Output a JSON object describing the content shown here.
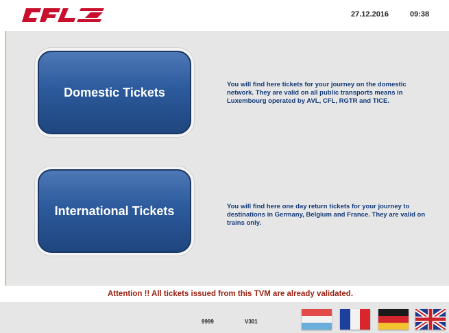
{
  "header": {
    "logo_text": "CFL",
    "date": "27.12.2016",
    "time": "09:38"
  },
  "tickets": {
    "domestic": {
      "label": "Domestic Tickets",
      "description": "You will find here tickets for your journey on the domestic network. They are valid on all public transports means in Luxembourg operated by AVL, CFL, RGTR and TICE."
    },
    "international": {
      "label": "International Tickets",
      "description": "You will find here one day return tickets for your journey to destinations in Germany, Belgium and France. They are valid on trains only."
    }
  },
  "notice": "Attention !! All tickets issued from this TVM are already validated.",
  "footer": {
    "code_1": "9999",
    "code_2": "V301",
    "languages": [
      {
        "flag": "luxembourg-flag-icon"
      },
      {
        "flag": "france-flag-icon"
      },
      {
        "flag": "germany-flag-icon"
      },
      {
        "flag": "uk-flag-icon"
      }
    ]
  },
  "colors": {
    "brand_red": "#c8102e",
    "button_blue": "#2c5a9c",
    "description_blue": "#123a78",
    "attention_red": "#9a1f0f",
    "background_gray": "#e6e6e6"
  }
}
